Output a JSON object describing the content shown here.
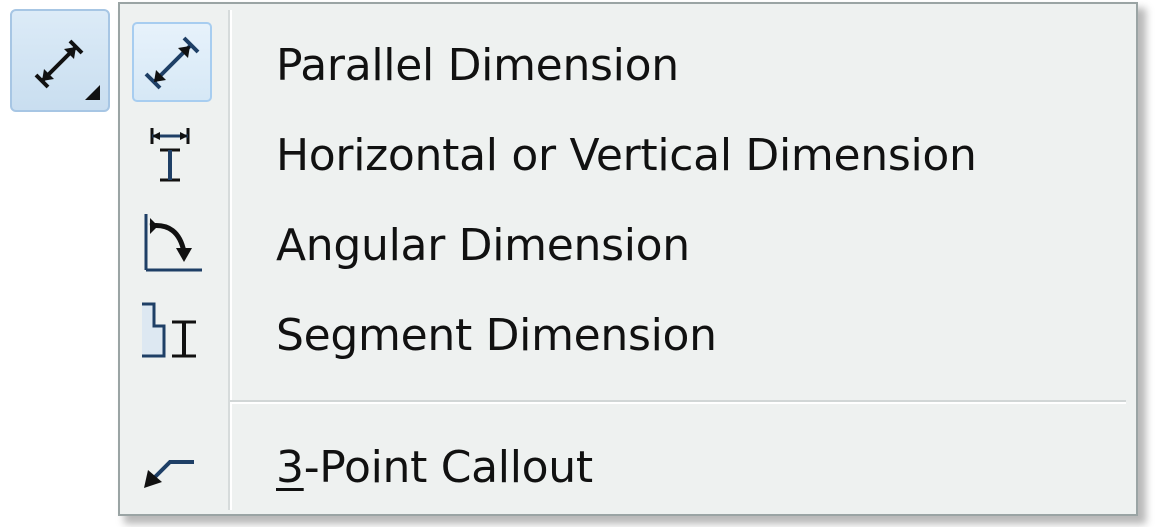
{
  "toolbar": {
    "tool_button": {
      "icon": "parallel-dimension-icon",
      "has_flyout": true
    }
  },
  "menu": {
    "items": [
      {
        "label": "Parallel Dimension",
        "icon": "parallel-dimension-icon",
        "checked": true
      },
      {
        "label": "Horizontal or Vertical Dimension",
        "icon": "horizontal-vertical-dimension-icon",
        "checked": false
      },
      {
        "label": "Angular Dimension",
        "icon": "angular-dimension-icon",
        "checked": false
      },
      {
        "label": "Segment Dimension",
        "icon": "segment-dimension-icon",
        "checked": false
      }
    ],
    "callout_item": {
      "mnemonic": "3",
      "rest": "-Point Callout",
      "icon": "three-point-callout-icon"
    }
  },
  "colors": {
    "menu_background": "#eef1f0",
    "menu_border": "#9aa4a4",
    "highlight_border": "#a7cdf0",
    "highlight_fill": "#d6e8f6",
    "icon_blue": "#1e3f66",
    "text": "#111111"
  }
}
